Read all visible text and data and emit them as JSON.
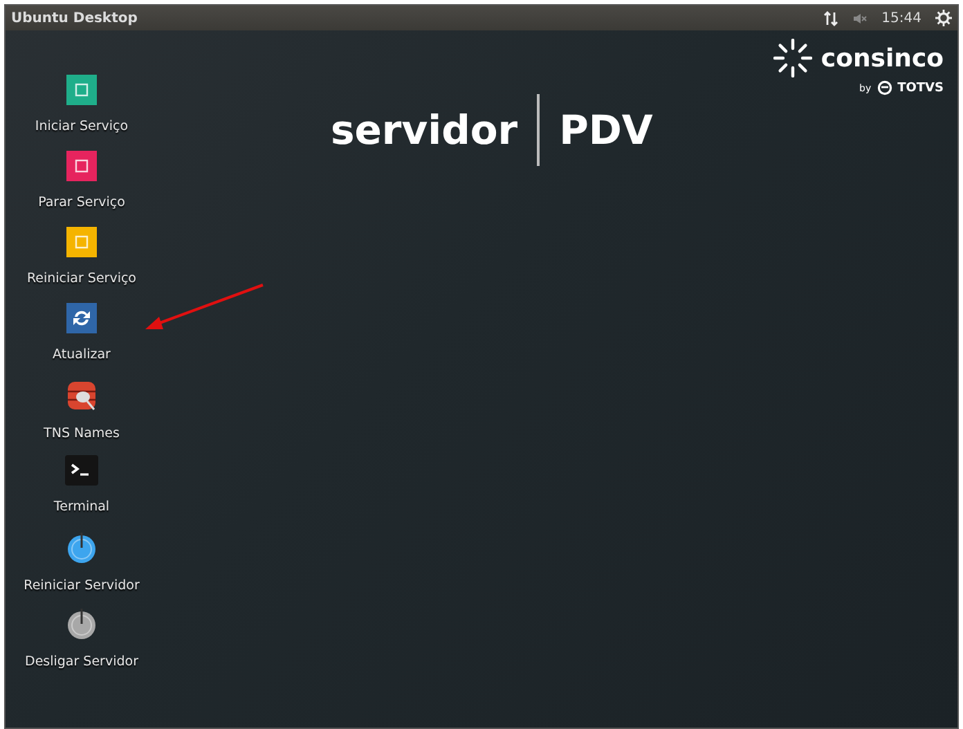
{
  "top_panel": {
    "title": "Ubuntu Desktop",
    "clock": "15:44"
  },
  "desktop_icons": [
    {
      "label": "Iniciar Serviço",
      "kind": "chip",
      "color": "#1fae8a"
    },
    {
      "label": "Parar Serviço",
      "kind": "chip",
      "color": "#e6245e"
    },
    {
      "label": "Reiniciar Serviço",
      "kind": "chip",
      "color": "#f5b400"
    },
    {
      "label": "Atualizar",
      "kind": "refresh",
      "color": "#2f66a8"
    },
    {
      "label": "TNS Names",
      "kind": "database",
      "color": "#d9452f"
    },
    {
      "label": "Terminal",
      "kind": "terminal",
      "color": "#141414"
    },
    {
      "label": "Reiniciar Servidor",
      "kind": "power",
      "color": "#3da5ee"
    },
    {
      "label": "Desligar Servidor",
      "kind": "power",
      "color": "#a8a8a8"
    }
  ],
  "wallpaper": {
    "title_left": "servidor",
    "title_right": "PDV",
    "brand": "consinco",
    "brand_by": "by",
    "brand_parent": "TOTVS"
  }
}
